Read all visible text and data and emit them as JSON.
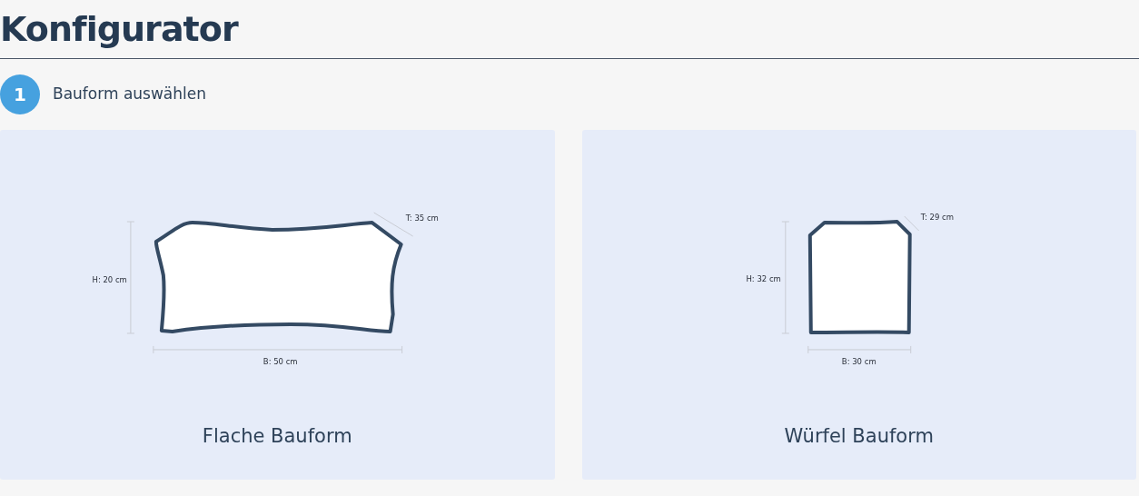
{
  "title": "Konfigurator",
  "step": {
    "number": "1",
    "label": "Bauform auswählen"
  },
  "options": [
    {
      "kind": "flat",
      "name": "Flache Bauform",
      "height": "H: 20 cm",
      "width": "B: 50 cm",
      "depth": "T: 35 cm"
    },
    {
      "kind": "cube",
      "name": "Würfel Bauform",
      "height": "H: 32 cm",
      "width": "B: 30 cm",
      "depth": "T: 29 cm"
    }
  ]
}
